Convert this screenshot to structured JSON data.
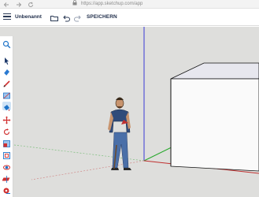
{
  "browser": {
    "url": "https://app.sketchup.com/app"
  },
  "toolbar": {
    "model_title": "Unbenannt",
    "save_label": "SPEICHERN"
  },
  "icons": {
    "back": "arrow-left-icon",
    "forward": "arrow-right-icon",
    "reload": "reload-icon",
    "lock": "lock-icon",
    "menu": "hamburger-menu-icon",
    "model_info": "folder-icon",
    "undo": "undo-icon",
    "redo": "redo-icon"
  },
  "tools": [
    "search-icon",
    "select-arrow-icon",
    "eraser-icon",
    "pencil-line-icon",
    "rectangle-icon",
    "paint-bucket-icon",
    "move-icon",
    "rotate-icon",
    "scale-icon",
    "offset-icon",
    "orbit-icon",
    "section-plane-icon",
    "tape-measure-icon",
    "tag-icon"
  ],
  "colors": {
    "viewport_bg": "#dededc",
    "axis_blue": "#3b3bd6",
    "axis_green": "#27a82c",
    "axis_red": "#c03030",
    "accent": "#1e73c8"
  }
}
